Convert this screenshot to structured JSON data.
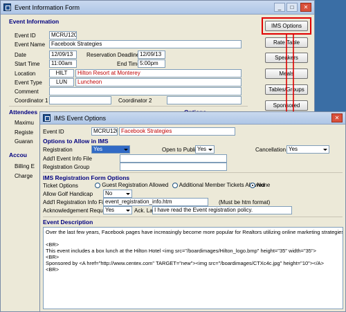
{
  "main_window": {
    "title": "Event Information Form",
    "section_event_info": "Event Information",
    "event_id_label": "Event ID",
    "event_id": "MCRU1209",
    "event_name_label": "Event Name",
    "event_name": "Facebook Strategies",
    "date_label": "Date",
    "date": "12/09/13",
    "reservation_deadline_label": "Reservation Deadline",
    "reservation_deadline": "12/09/13",
    "start_time_label": "Start Time",
    "start_time": "11:00am",
    "end_time_label": "End Time",
    "end_time": "5:00pm",
    "location_label": "Location",
    "location_code": "HILT",
    "location_name": "Hilton Resort at Monterey",
    "event_type_label": "Event Type",
    "event_type_code": "LUN",
    "event_type_name": "Luncheon",
    "comment_label": "Comment",
    "coordinator1_label": "Coordinator 1",
    "coordinator2_label": "Coordinator 2",
    "attendees_label": "Attendees",
    "options_label": "Options",
    "maxim_label": "Maximu",
    "regist_label": "Registe",
    "guara_label": "Guaran",
    "accou_label": "Accou",
    "billing_label": "Billing E",
    "charge_label": "Charge",
    "buttons": {
      "ims_options": "IMS Options",
      "rate_table": "Rate Table",
      "speakers": "Speakers",
      "meals": "Meals",
      "tables_groups": "Tables/Groups",
      "sponsored_items": "Sponsored Items"
    }
  },
  "ims_window": {
    "title": "IMS Event Options",
    "event_id_label": "Event ID",
    "event_id": "MCRU1209",
    "event_name": "Facebook Strategies",
    "section_allow": "Options to Allow in IMS",
    "registration_label": "Registration",
    "registration_value": "Yes",
    "open_public_label": "Open to Public",
    "open_public_value": "Yes",
    "cancellation_label": "Cancellation",
    "cancellation_value": "Yes",
    "addl_info_label": "Add'l Event Info File",
    "reg_group_label": "Registration Group",
    "section_form": "IMS Registration Form Options",
    "ticket_options_label": "Ticket Options",
    "radio_guest": "Guest Registration Allowed",
    "radio_additional": "Additional Member Tickets Allowed",
    "radio_none": "None",
    "ticket_selected": "None",
    "golf_label": "Allow Golf Handicap",
    "golf_value": "No",
    "addl_info_reg_label": "Add'l Registration Info File",
    "addl_info_reg_value": "event_registration_info.htm",
    "htm_note": "(Must be htm format)",
    "ack_required_label": "Acknowledgement Required",
    "ack_required_value": "Yes",
    "ack_label_label": "Ack. Label",
    "ack_label_value": "I have read the Event registration policy.",
    "section_desc": "Event Description",
    "description": "Over the last few years, Facebook pages have increasingly become more popular for Realtors utilizing online marketing strategies. We will cover things like F\n\n<BR>\nThis event includes a box lunch at the Hilton Hotel <img src=\"/boardimages/Hilton_logo.bmp\" height=\"35\" width=\"35\">\n<BR>\nSponsored by <A href=\"http://www.centex.com\" TARGET=\"new\"><img src=\"/boardimages/CTXc4c.jpg\" height=\"10\"></A>\n<BR>"
  },
  "colors": {
    "section": "#000080",
    "highlight": "#e00000",
    "select_blue": "#316ac5"
  }
}
